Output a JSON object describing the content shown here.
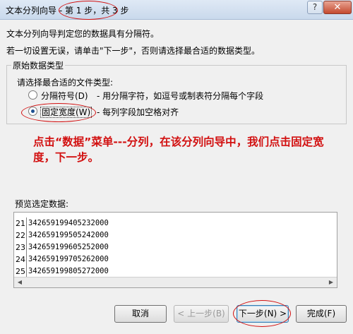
{
  "window": {
    "title_prefix": "文本分列向导 - ",
    "title_step": "第 1 步，共 3 步",
    "help_label": "?",
    "close_label": "✕"
  },
  "intro": {
    "line1": "文本分列向导判定您的数据具有分隔符。",
    "line2": "若一切设置无误，请单击\"下一步\"，否则请选择最合适的数据类型。"
  },
  "group": {
    "legend": "原始数据类型",
    "prompt": "请选择最合适的文件类型:",
    "options": [
      {
        "label": "分隔符号(D)",
        "desc": "- 用分隔字符，如逗号或制表符分隔每个字段",
        "checked": false
      },
      {
        "label": "固定宽度(W)",
        "desc": "- 每列字段加空格对齐",
        "checked": true
      }
    ]
  },
  "annotation": {
    "text": "点击“数据”菜单---分列，在该分列向导中，我们点击固定宽度，下一步。"
  },
  "preview": {
    "label": "预览选定数据:",
    "rows": [
      {
        "num": "21",
        "text": "342659199405232000"
      },
      {
        "num": "22",
        "text": "342659199505242000"
      },
      {
        "num": "23",
        "text": "342659199605252000"
      },
      {
        "num": "24",
        "text": "342659199705262000"
      },
      {
        "num": "25",
        "text": "342659199805272000"
      }
    ]
  },
  "buttons": {
    "cancel": "取消",
    "back": "< 上一步(B)",
    "next": "下一步(N) >",
    "finish": "完成(F)"
  }
}
